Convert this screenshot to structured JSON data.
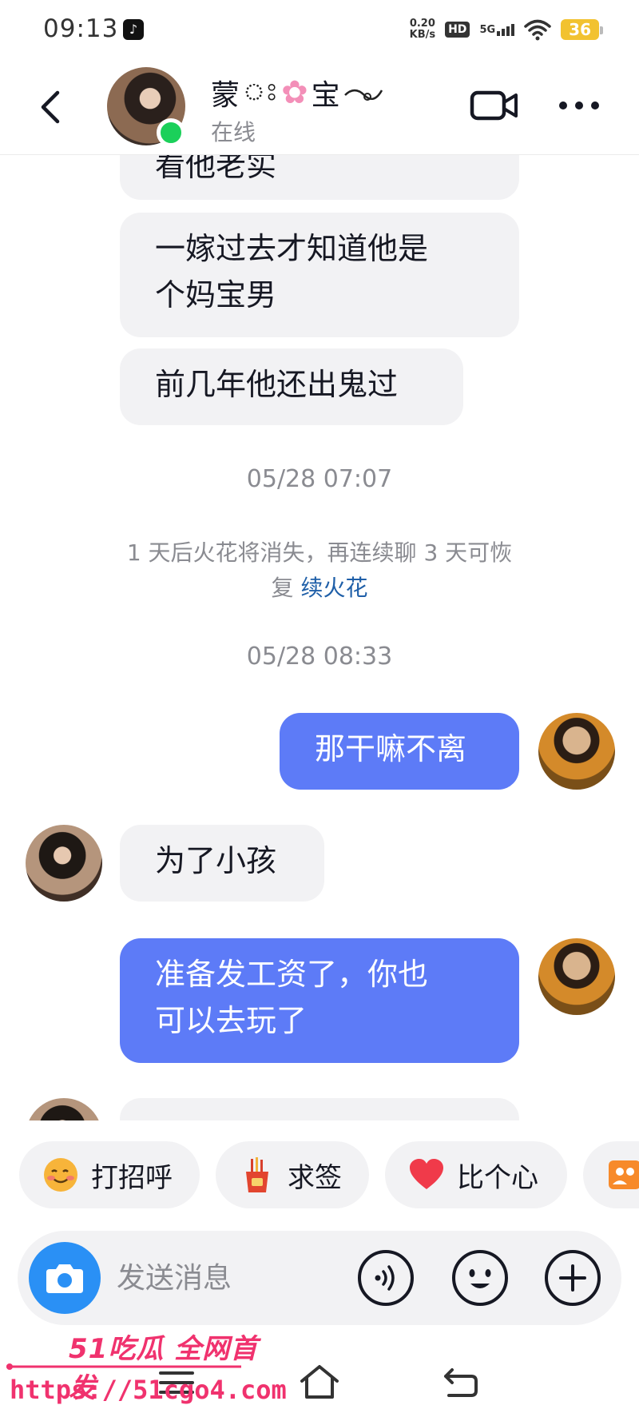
{
  "status_bar": {
    "time": "09:13",
    "net_speed_value": "0.20",
    "net_speed_unit": "KB/s",
    "hd": "HD",
    "network": "5G",
    "battery": "36"
  },
  "header": {
    "name_part1": "蒙",
    "name_part2": "宝",
    "status": "在线"
  },
  "chat": {
    "messages": [
      {
        "from": "her",
        "text": "看他老实"
      },
      {
        "from": "her",
        "text": "一嫁过去才知道他是\n个妈宝男"
      },
      {
        "from": "her",
        "text": "前几年他还出鬼过"
      },
      {
        "from": "me",
        "text": "那干嘛不离"
      },
      {
        "from": "her",
        "text": "为了小孩"
      },
      {
        "from": "me",
        "text": "准备发工资了，你也\n可以去玩了"
      }
    ],
    "timestamps": [
      "05/28 07:07",
      "05/28 08:33"
    ],
    "notice_line1": "1 天后火花将消失，再连续聊 3 天可恢",
    "notice_line2": "复",
    "notice_link": "续火花"
  },
  "quick_replies": [
    {
      "label": "打招呼",
      "icon": "waving-emoji-icon"
    },
    {
      "label": "求签",
      "icon": "fortune-sticks-icon"
    },
    {
      "label": "比个心",
      "icon": "heart-icon"
    }
  ],
  "input": {
    "placeholder": "发送消息"
  },
  "watermark": {
    "brand": "51吃瓜 全网首发",
    "url": "https://51cgo4.com"
  },
  "colors": {
    "outgoing_bubble": "#5d7bf7",
    "incoming_bubble": "#f2f2f4",
    "link": "#1f5fa8",
    "online": "#1bd05a",
    "camera": "#2a90f5",
    "watermark": "#f0326e"
  }
}
